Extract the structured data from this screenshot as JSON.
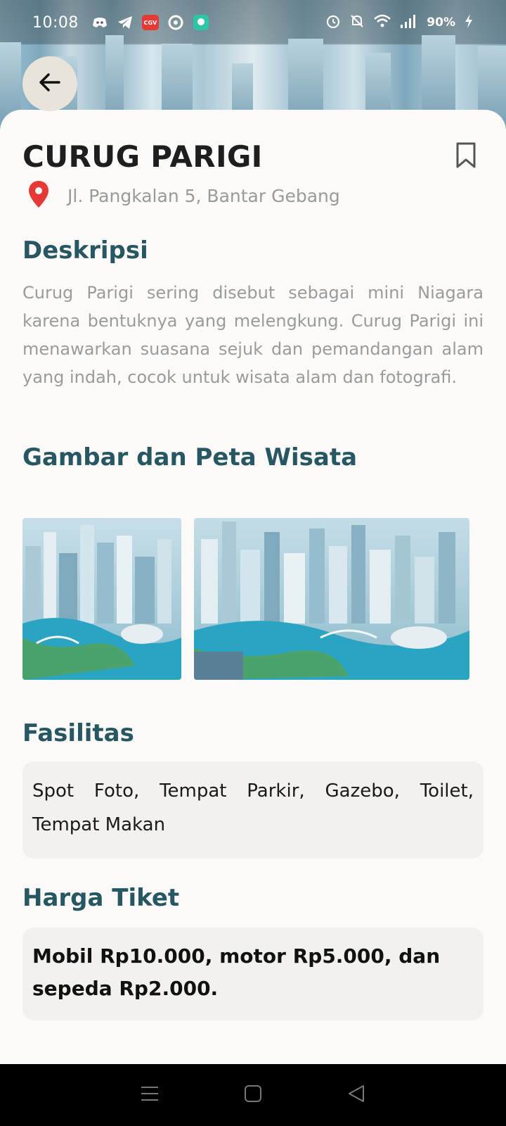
{
  "status_bar": {
    "time": "10:08",
    "battery": "90%",
    "app_icons": [
      "discord-icon",
      "telegram-icon",
      "cgv-icon",
      "vpn-icon",
      "chat-icon"
    ]
  },
  "place": {
    "title": "CURUG PARIGI",
    "location": "Jl. Pangkalan 5, Bantar Gebang"
  },
  "sections": {
    "description_heading": "Deskripsi",
    "description": "Curug Parigi sering disebut sebagai mini Niagara karena bentuknya yang melengkung. Curug Parigi ini menawarkan suasana sejuk dan pemandangan alam yang indah, cocok untuk wisata alam dan fotografi.",
    "gallery_heading": "Gambar dan Peta Wisata",
    "facilities_heading": "Fasilitas",
    "facilities": "Spot Foto, Tempat Parkir, Gazebo, Toilet, Tempat Makan",
    "price_heading": "Harga Tiket",
    "price": "Mobil Rp10.000, motor Rp5.000, dan sepeda Rp2.000."
  },
  "colors": {
    "heading": "#265762",
    "pin": "#e53935",
    "sheet_bg": "#fbfaf8",
    "box_bg": "#f2f1ed"
  }
}
